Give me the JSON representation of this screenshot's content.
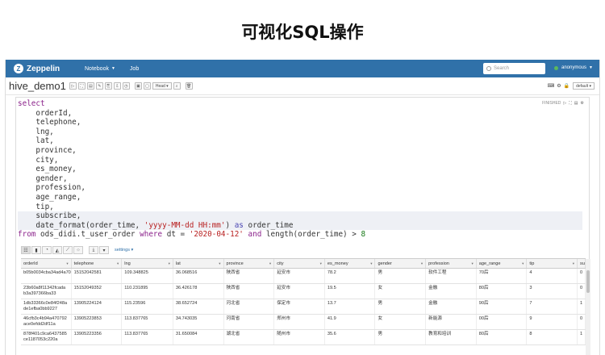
{
  "slide_title": "可视化SQL操作",
  "navbar": {
    "logo": "Zeppelin",
    "menu_notebook": "Notebook",
    "menu_job": "Job",
    "search_placeholder": "Search",
    "user": "anonymous",
    "colors": {
      "bar": "#3071a9",
      "status_dot": "#5cb85c"
    }
  },
  "notebook": {
    "title": "hive_demo1",
    "head_select": "Head",
    "default_select": "default"
  },
  "paragraph": {
    "status": "FINISHED",
    "settings_label": "settings",
    "code_lines": [
      "select",
      "    orderId,",
      "    telephone,",
      "    lng,",
      "    lat,",
      "    province,",
      "    city,",
      "    es_money,",
      "    gender,",
      "    profession,",
      "    age_range,",
      "    tip,",
      "    subscribe,",
      "    date_format(order_time, 'yyyy-MM-dd HH:mm') as order_time",
      "from ods_didi.t_user_order where dt = '2020-04-12' and length(order_time) > 8"
    ]
  },
  "table": {
    "columns": [
      "orderId",
      "telephone",
      "lng",
      "lat",
      "province",
      "city",
      "es_money",
      "gender",
      "profession",
      "age_range",
      "tip",
      "su"
    ],
    "rows": [
      [
        "b05b0034cba34ad4a707b4e67f681c71",
        "15152042581",
        "109.348825",
        "36.068516",
        "陕西省",
        "延安市",
        "78.2",
        "男",
        "软件工程",
        "70后",
        "4",
        "0"
      ],
      [
        "23b60a8f11342fcada b3a397366ba33",
        "15152049352",
        "110.231895",
        "36.426178",
        "陕西省",
        "延安市",
        "19.5",
        "女",
        "金融",
        "80后",
        "3",
        "0"
      ],
      [
        "1db33366c0e84f248a de1efba0bb9227",
        "13905224124",
        "115.23596",
        "38.652724",
        "河北省",
        "保定市",
        "13.7",
        "男",
        "金融",
        "90后",
        "7",
        "1"
      ],
      [
        "46cfb3c4b94a470792 ace0efdd2df11a",
        "13905223853",
        "113.837765",
        "34.743035",
        "河南省",
        "郑州市",
        "41.9",
        "女",
        "新能源",
        "00后",
        "9",
        "0"
      ],
      [
        "878f401c9ca6437585 ce1187053c220a",
        "13905223356",
        "113.837765",
        "31.650084",
        "湖北省",
        "随州市",
        "35.6",
        "男",
        "教育和培训",
        "80后",
        "8",
        "1"
      ]
    ]
  }
}
